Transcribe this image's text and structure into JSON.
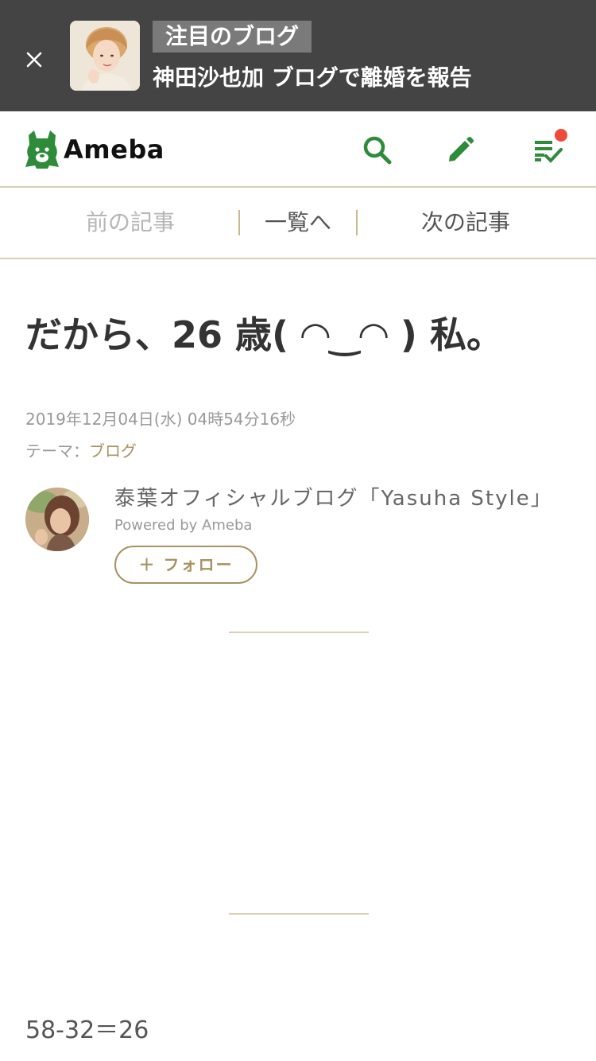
{
  "banner": {
    "close_icon": "close-icon",
    "tag": "注目のブログ",
    "headline": "神田沙也加 ブログで離婚を報告"
  },
  "header": {
    "logo_text": "Ameba",
    "brand_color": "#2e8b3a",
    "icons": [
      "search-icon",
      "pencil-icon",
      "checklist-icon"
    ],
    "notification_dot_color": "#f04a3a"
  },
  "article_nav": {
    "prev": "前の記事",
    "list": "一覧へ",
    "next": "次の記事"
  },
  "article": {
    "title": "だから、26 歳( ◠‿◠ ) 私。",
    "date": "2019年12月04日(水) 04時54分16秒",
    "theme_label": "テーマ：",
    "theme_value": "ブログ",
    "body": "58-32＝26"
  },
  "author": {
    "blog_name": "泰葉オフィシャルブログ「Yasuha Style」",
    "powered_by": "Powered by Ameba",
    "follow_label": "＋ フォロー"
  },
  "colors": {
    "banner_bg": "#444444",
    "accent_gold": "#a89263",
    "divider": "#d9cfb3"
  }
}
